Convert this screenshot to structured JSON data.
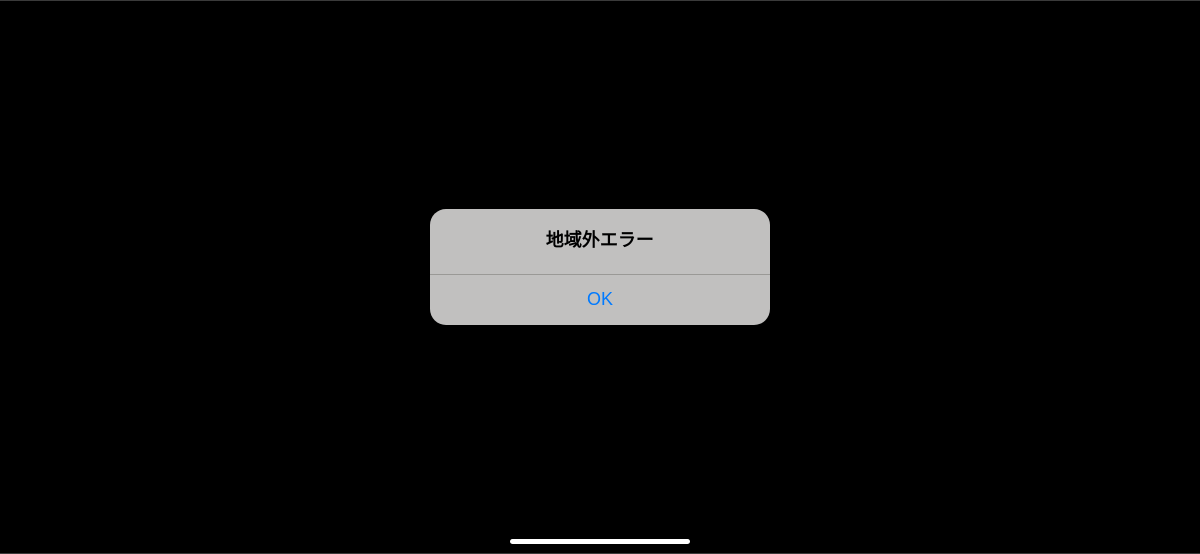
{
  "alert": {
    "title": "地域外エラー",
    "ok_label": "OK"
  }
}
